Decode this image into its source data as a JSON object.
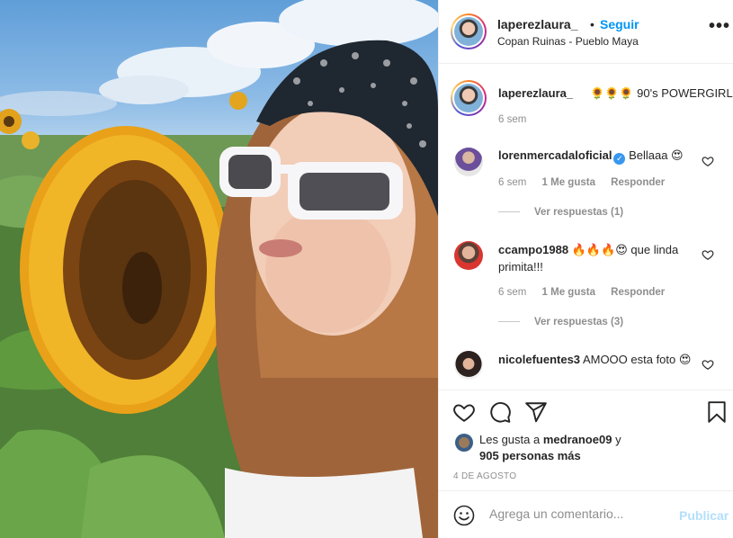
{
  "header": {
    "username": "laperezlaura_",
    "dot": "•",
    "follow_label": "Seguir",
    "location": "Copan Ruinas - Pueblo Maya",
    "more_label": "•••"
  },
  "caption": {
    "username": "laperezlaura_",
    "text": "🌻🌻🌻 90's POWERGIRL",
    "time": "6 sem"
  },
  "comments": [
    {
      "username": "lorenmercadaloficial",
      "text": "Bellaaa 😍",
      "time": "6 sem",
      "likes": "1 Me gusta",
      "reply_label": "Responder",
      "view_replies": "Ver respuestas (1)"
    },
    {
      "username": "ccampo1988",
      "text": "🔥🔥🔥😍 que linda primita!!!",
      "time": "6 sem",
      "likes": "1 Me gusta",
      "reply_label": "Responder",
      "view_replies": "Ver respuestas (3)"
    },
    {
      "username": "nicolefuentes3",
      "text": "AMOOO esta foto 😍"
    }
  ],
  "likes": {
    "prefix": "Les gusta a",
    "user": "medranoe09",
    "conj": "y",
    "count": "905 personas más"
  },
  "date": "4 DE AGOSTO",
  "add_comment": {
    "placeholder": "Agrega un comentario...",
    "publish_label": "Publicar"
  },
  "colors": {
    "accent": "#0095f6",
    "publish_disabled": "#b2dffc",
    "muted": "#8e8e8e"
  },
  "icons": [
    "heart-icon",
    "comment-icon",
    "share-icon",
    "bookmark-icon",
    "emoji-icon",
    "more-icon",
    "verified-icon"
  ]
}
